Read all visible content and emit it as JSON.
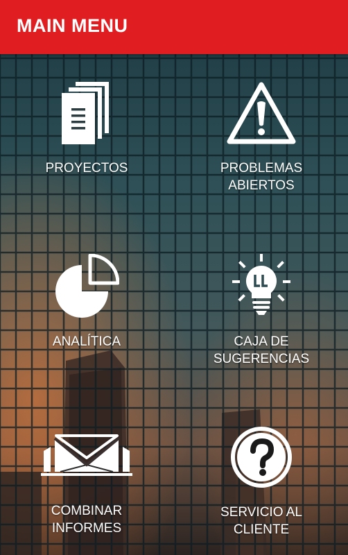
{
  "appbar": {
    "title": "MAIN MENU",
    "color": "#e01e22"
  },
  "menu": [
    {
      "line1": "PROYECTOS",
      "line2": "",
      "icon": "documents-icon"
    },
    {
      "line1": "PROBLEMAS",
      "line2": "ABIERTOS",
      "icon": "warning-icon"
    },
    {
      "line1": "ANALÍTICA",
      "line2": "",
      "icon": "pie-chart-icon"
    },
    {
      "line1": "CAJA DE",
      "line2": "SUGERENCIAS",
      "icon": "lightbulb-icon"
    },
    {
      "line1": "COMBINAR",
      "line2": "INFORMES",
      "icon": "mail-merge-icon"
    },
    {
      "line1": "SERVICIO AL",
      "line2": "CLIENTE",
      "icon": "help-icon"
    }
  ]
}
